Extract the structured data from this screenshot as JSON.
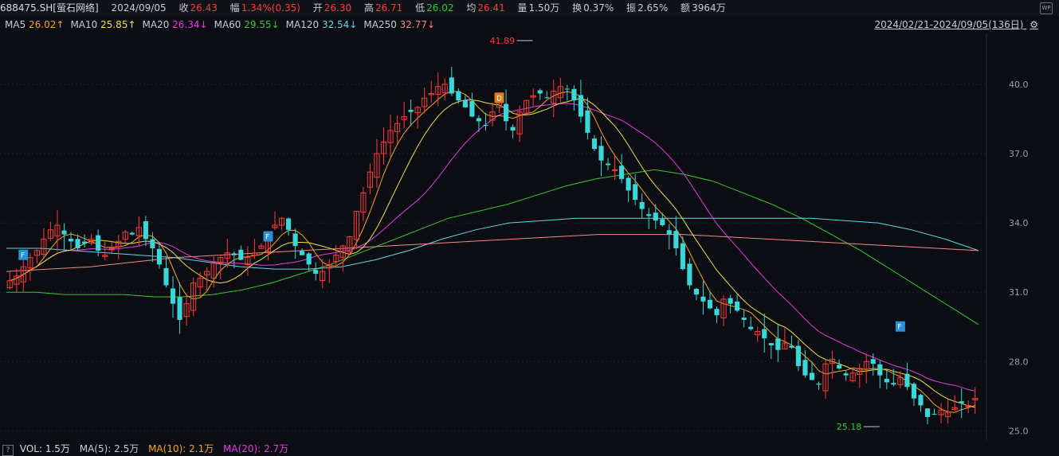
{
  "header": {
    "stock": "688475.SH[萤石网络]",
    "date": "2024/09/05",
    "close_label": "收",
    "close": "26.43",
    "chg_label": "幅",
    "chg": "1.34%(0.35)",
    "open_label": "开",
    "open": "26.30",
    "high_label": "高",
    "high": "26.71",
    "low_label": "低",
    "low": "26.02",
    "avg_label": "均",
    "avg": "26.41",
    "vol_label": "量",
    "vol": "1.50万",
    "turn_label": "换",
    "turn": "0.37%",
    "amp_label": "振",
    "amp": "2.65%",
    "amt_label": "额",
    "amt": "3964万",
    "wp_icon": "WP"
  },
  "ma_legend": [
    {
      "label": "MA5",
      "value": "26.02↑",
      "color": "#f5a623"
    },
    {
      "label": "MA10",
      "value": "25.85↑",
      "color": "#f1e04a"
    },
    {
      "label": "MA20",
      "value": "26.34↓",
      "color": "#e13ee6"
    },
    {
      "label": "MA60",
      "value": "29.55↓",
      "color": "#35c835"
    },
    {
      "label": "MA120",
      "value": "32.54↓",
      "color": "#5fd6e6"
    },
    {
      "label": "MA250",
      "value": "32.77↓",
      "color": "#f08a8a"
    }
  ],
  "range": "2024/02/21-2024/09/05(136日)",
  "volume": {
    "vol": "VOL: 1.5万",
    "ma5": "MA(5): 2.5万",
    "ma10": "MA(10): 2.1万",
    "ma20": "MA(20): 2.7万"
  },
  "colors": {
    "up": "#ff3b3b",
    "down": "#3ad6d8",
    "grid": "#1e232c"
  },
  "chart_data": {
    "type": "candlestick",
    "y_ticks": [
      25.0,
      28.0,
      31.0,
      34.0,
      37.0,
      40.0
    ],
    "ylim": [
      24.6,
      42.2
    ],
    "annotations": [
      {
        "label": "41.89",
        "value": 41.89,
        "index": 76
      },
      {
        "label": "25.18",
        "value": 25.18,
        "index": 127
      }
    ],
    "markers": [
      {
        "label": "F",
        "index": 2,
        "value": 32.6
      },
      {
        "label": "F",
        "index": 38,
        "value": 33.4
      },
      {
        "label": "D",
        "index": 72,
        "value": 39.4
      },
      {
        "label": "F",
        "index": 131,
        "value": 29.5
      }
    ],
    "close": [
      31.5,
      31.7,
      32.1,
      32.5,
      32.8,
      33.3,
      33.7,
      33.9,
      33.5,
      33.2,
      32.9,
      33.1,
      33.3,
      32.8,
      32.6,
      32.9,
      33.2,
      33.6,
      33.5,
      33.8,
      33.3,
      32.9,
      32.2,
      31.3,
      30.5,
      29.8,
      30.5,
      31.4,
      31.6,
      31.9,
      32.3,
      32.5,
      32.7,
      32.6,
      32.4,
      32.5,
      32.7,
      33.0,
      33.6,
      33.9,
      34.2,
      33.7,
      33.0,
      32.6,
      32.2,
      31.8,
      31.9,
      32.2,
      32.6,
      33.0,
      33.4,
      34.5,
      35.3,
      36.2,
      37.0,
      37.5,
      38.0,
      38.3,
      38.6,
      38.8,
      39.0,
      39.4,
      39.6,
      39.9,
      40.0,
      39.6,
      39.3,
      39.0,
      38.6,
      38.4,
      38.2,
      38.8,
      39.2,
      38.4,
      38.0,
      38.8,
      39.3,
      39.5,
      39.6,
      39.4,
      39.7,
      39.9,
      39.8,
      39.3,
      38.6,
      37.9,
      37.2,
      36.7,
      36.5,
      36.3,
      35.9,
      35.4,
      35.0,
      34.6,
      34.3,
      34.1,
      33.9,
      33.5,
      32.9,
      32.0,
      31.3,
      30.9,
      30.6,
      30.3,
      30.0,
      30.7,
      30.5,
      30.2,
      29.8,
      29.4,
      29.3,
      29.0,
      28.7,
      28.5,
      28.8,
      28.6,
      27.8,
      27.4,
      27.2,
      27.0,
      27.9,
      28.1,
      27.7,
      27.4,
      27.5,
      27.7,
      28.0,
      27.9,
      27.4,
      27.1,
      27.0,
      27.3,
      26.9,
      26.4,
      26.1,
      25.6,
      25.7,
      25.9,
      25.8,
      26.0,
      26.2,
      26.1,
      26.4
    ],
    "ma_series": {
      "MA60": [
        31.0,
        31.0,
        30.9,
        30.9,
        30.9,
        30.8,
        30.8,
        30.9,
        31.1,
        31.4,
        31.8,
        32.2,
        32.7,
        33.2,
        33.7,
        34.2,
        34.5,
        34.8,
        35.2,
        35.6,
        35.9,
        36.1,
        36.3,
        36.1,
        35.8,
        35.3,
        34.8,
        34.2,
        33.5,
        32.8,
        32.0,
        31.2,
        30.4,
        29.6
      ],
      "MA120": [
        32.9,
        32.9,
        32.8,
        32.7,
        32.6,
        32.5,
        32.3,
        32.1,
        32.0,
        32.0,
        32.1,
        32.4,
        32.8,
        33.3,
        33.7,
        34.0,
        34.1,
        34.2,
        34.2,
        34.2,
        34.2,
        34.2,
        34.2,
        34.2,
        34.2,
        34.1,
        34.0,
        33.7,
        33.3,
        32.8
      ],
      "MA250": [
        31.9,
        32.0,
        32.1,
        32.3,
        32.5,
        32.6,
        32.7,
        32.8,
        32.9,
        33.0,
        33.1,
        33.2,
        33.3,
        33.4,
        33.5,
        33.5,
        33.5,
        33.4,
        33.3,
        33.2,
        33.1,
        33.0,
        32.9,
        32.8
      ]
    }
  }
}
